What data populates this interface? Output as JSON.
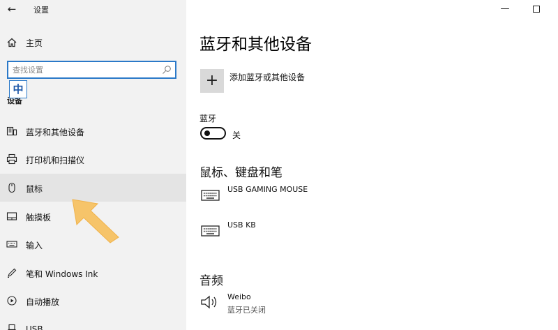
{
  "window": {
    "title": "设置",
    "back_glyph": "←",
    "minimize_glyph": "—"
  },
  "sidebar": {
    "home_label": "主页",
    "search_placeholder": "查找设置",
    "ime_indicator": "中",
    "section_label": "设备",
    "items": [
      {
        "label": "蓝牙和其他设备",
        "icon": "bluetooth-devices-icon"
      },
      {
        "label": "打印机和扫描仪",
        "icon": "printer-icon"
      },
      {
        "label": "鼠标",
        "icon": "mouse-icon",
        "selected": true
      },
      {
        "label": "触摸板",
        "icon": "touchpad-icon"
      },
      {
        "label": "输入",
        "icon": "keyboard-icon"
      },
      {
        "label": "笔和 Windows Ink",
        "icon": "pen-icon"
      },
      {
        "label": "自动播放",
        "icon": "autoplay-icon"
      },
      {
        "label": "USB",
        "icon": "usb-icon"
      }
    ]
  },
  "main": {
    "title": "蓝牙和其他设备",
    "add_device_label": "添加蓝牙或其他设备",
    "bluetooth": {
      "label": "蓝牙",
      "state": "关",
      "on": false
    },
    "sections": [
      {
        "title": "鼠标、键盘和笔",
        "devices": [
          {
            "name": "USB GAMING MOUSE",
            "status": "",
            "icon": "keyboard-icon"
          },
          {
            "name": "USB KB",
            "status": "",
            "icon": "keyboard-icon"
          }
        ]
      },
      {
        "title": "音频",
        "devices": [
          {
            "name": "Weibo",
            "status": "蓝牙已关闭",
            "icon": "speaker-icon"
          }
        ]
      }
    ]
  },
  "colors": {
    "accent": "#2b79c8",
    "sidebar_bg": "#f2f2f2",
    "selected_bg": "#e4e4e4",
    "arrow": "#f6c46a"
  }
}
